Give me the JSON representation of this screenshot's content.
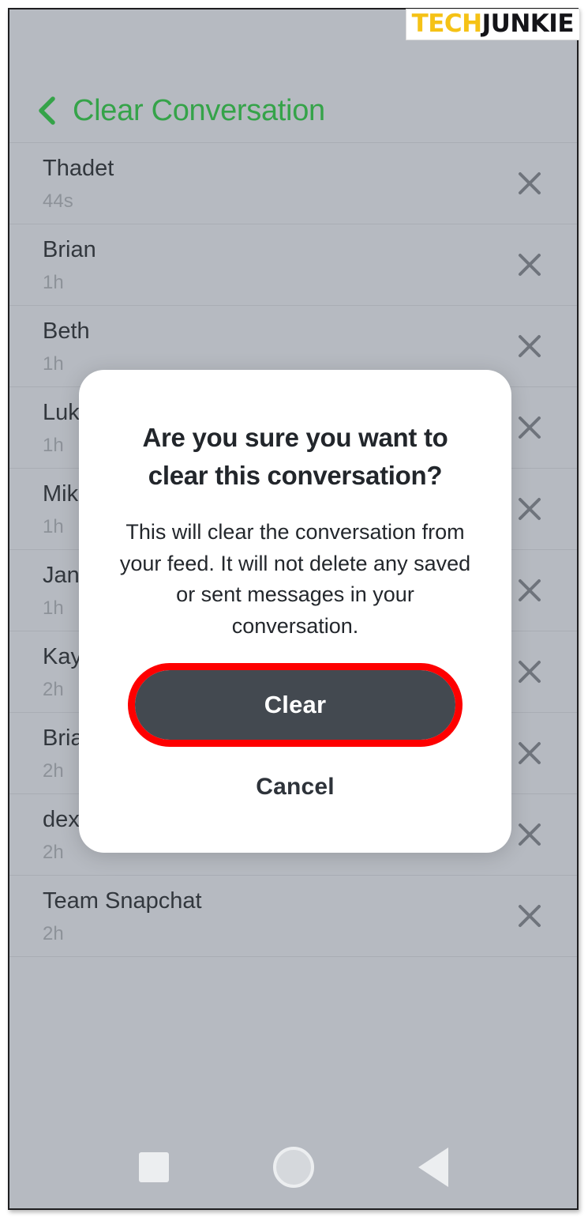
{
  "watermark": {
    "part1": "TECH",
    "part2": "JUNKIE"
  },
  "header": {
    "title": "Clear Conversation",
    "back_icon": "chevron-left-icon"
  },
  "conversations": [
    {
      "name": "Thadet",
      "time": "44s",
      "close_icon": "close-icon"
    },
    {
      "name": "Brian",
      "time": "1h",
      "close_icon": "close-icon"
    },
    {
      "name": "Beth",
      "time": "1h",
      "close_icon": "close-icon"
    },
    {
      "name": "Luk",
      "time": "1h",
      "close_icon": "close-icon"
    },
    {
      "name": "Mik",
      "time": "1h",
      "close_icon": "close-icon"
    },
    {
      "name": "Jan",
      "time": "1h",
      "close_icon": "close-icon"
    },
    {
      "name": "Kay",
      "time": "2h",
      "close_icon": "close-icon"
    },
    {
      "name": "Bria",
      "time": "2h",
      "close_icon": "close-icon"
    },
    {
      "name": "dex",
      "time": "2h",
      "close_icon": "close-icon"
    },
    {
      "name": "Team Snapchat",
      "time": "2h",
      "close_icon": "close-icon"
    }
  ],
  "dialog": {
    "title": "Are you sure you want to clear this conversation?",
    "body": "This will clear the conversation from your feed. It will not delete any saved or sent messages in your conversation.",
    "confirm_label": "Clear",
    "cancel_label": "Cancel"
  },
  "nav_bar": {
    "recents_icon": "square-recents-icon",
    "home_icon": "circle-home-icon",
    "back_icon": "triangle-back-icon"
  },
  "colors": {
    "accent_green": "#35a349",
    "app_background": "#b6bac1",
    "dialog_background": "#ffffff",
    "confirm_button": "#434950",
    "annotation_red": "#fe0000",
    "watermark_yellow": "#f5c216"
  }
}
